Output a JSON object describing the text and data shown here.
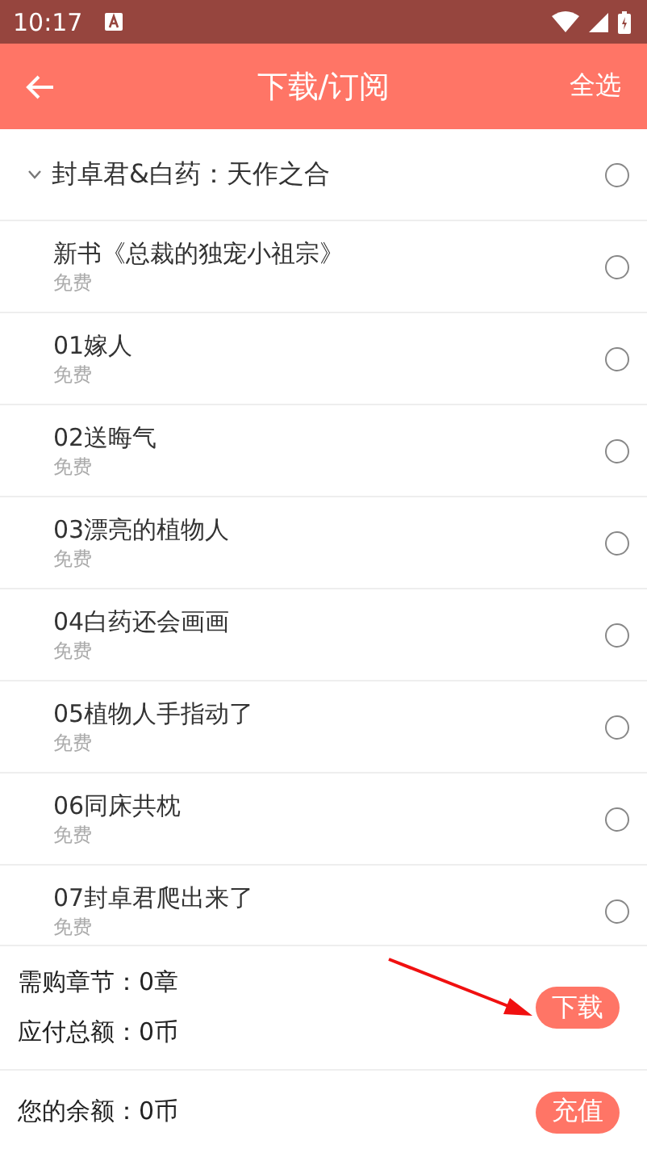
{
  "status_bar": {
    "time": "10:17"
  },
  "app_bar": {
    "title": "下载/订阅",
    "action": "全选"
  },
  "volume": {
    "title": "封卓君&白药：天作之合",
    "expanded": true,
    "selected": false
  },
  "chapters": [
    {
      "title": "新书《总裁的独宠小祖宗》",
      "price": "免费",
      "selected": false
    },
    {
      "title": "01嫁人",
      "price": "免费",
      "selected": false
    },
    {
      "title": "02送晦气",
      "price": "免费",
      "selected": false
    },
    {
      "title": "03漂亮的植物人",
      "price": "免费",
      "selected": false
    },
    {
      "title": "04白药还会画画",
      "price": "免费",
      "selected": false
    },
    {
      "title": "05植物人手指动了",
      "price": "免费",
      "selected": false
    },
    {
      "title": "06同床共枕",
      "price": "免费",
      "selected": false
    },
    {
      "title": "07封卓君爬出来了",
      "price": "免费",
      "selected": false
    }
  ],
  "summary": {
    "chapters_needed": "需购章节：0章",
    "total_due": "应付总额：0币",
    "download_button": "下载"
  },
  "balance": {
    "text": "您的余额：0币",
    "recharge_button": "充值"
  }
}
